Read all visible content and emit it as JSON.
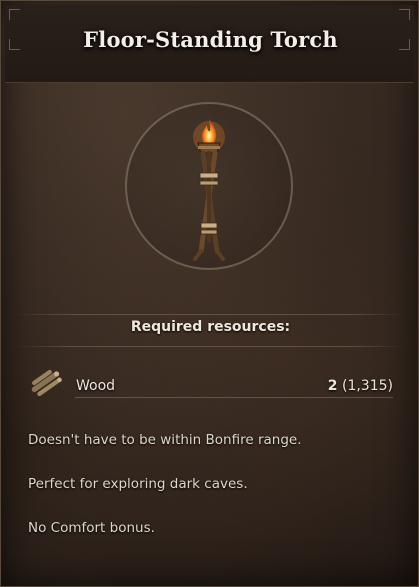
{
  "tooltip": {
    "title": "Floor-Standing Torch",
    "item_icon": "torch-icon",
    "section_label": "Required resources:",
    "resources": [
      {
        "icon": "wood-icon",
        "name": "Wood",
        "required": "2",
        "owned": "(1,315)"
      }
    ],
    "descriptions": [
      "Doesn't have to be within Bonfire range.",
      "Perfect for exploring dark caves.",
      "No Comfort bonus."
    ]
  }
}
